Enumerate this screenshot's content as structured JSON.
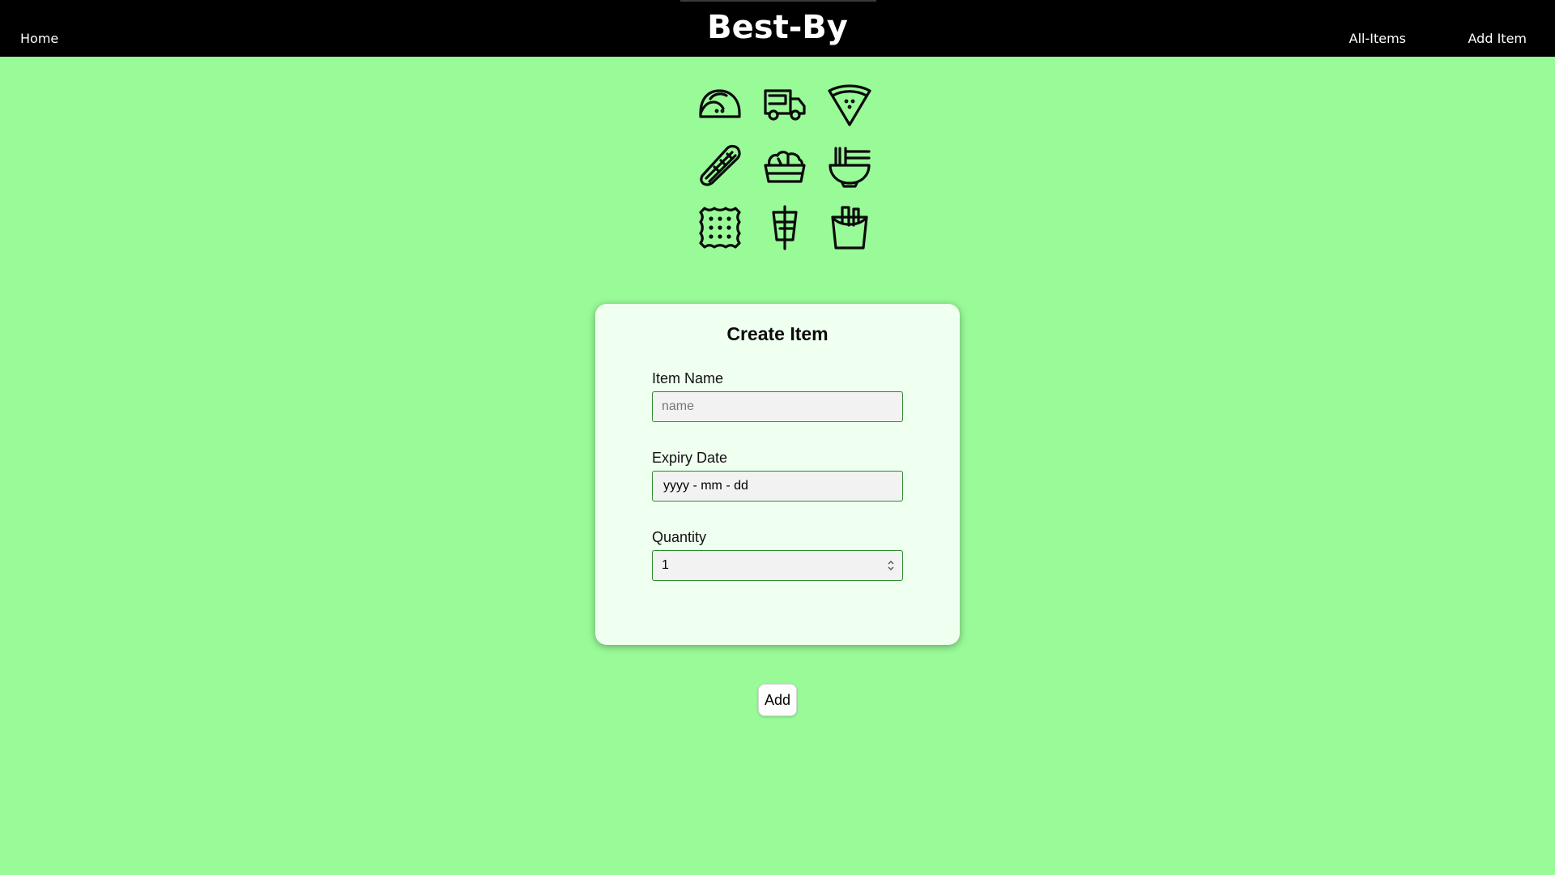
{
  "navbar": {
    "brand": "Best-By",
    "home_label": "Home",
    "all_items_label": "All-Items",
    "add_item_label": "Add Item"
  },
  "icons": [
    "taco-icon",
    "food-truck-icon",
    "pizza-slice-icon",
    "hot-dog-icon",
    "salad-bowl-icon",
    "noodle-bowl-icon",
    "cracker-icon",
    "kebab-icon",
    "fries-box-icon"
  ],
  "form": {
    "title": "Create Item",
    "name_label": "Item Name",
    "name_placeholder": "name",
    "name_value": "",
    "expiry_label": "Expiry Date",
    "expiry_value": "yyyy - mm - dd",
    "quantity_label": "Quantity",
    "quantity_value": "1"
  },
  "add_button_label": "Add",
  "colors": {
    "background": "#99fb98",
    "navbar": "#000000",
    "card": "#effff0",
    "input_border": "#2b8a2b"
  }
}
